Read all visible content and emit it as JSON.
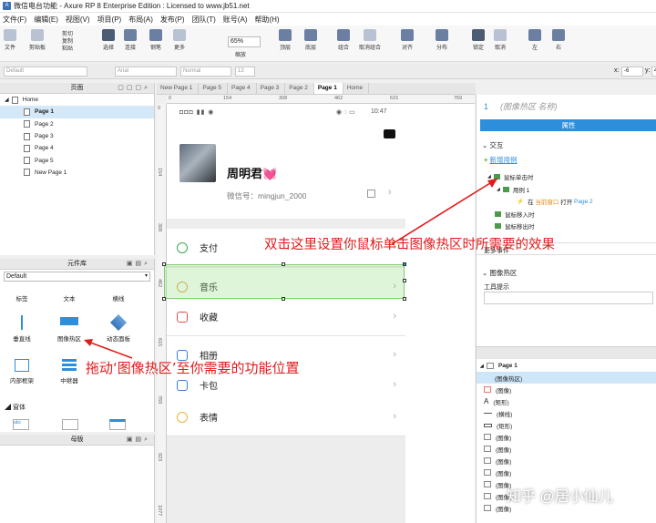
{
  "window": {
    "title": "微信电台功能 - Axure RP 8 Enterprise Edition : Licensed to www.jb51.net"
  },
  "menu": [
    "文件(F)",
    "编辑(E)",
    "视图(V)",
    "项目(P)",
    "布局(A)",
    "发布(P)",
    "团队(T)",
    "账号(A)",
    "帮助(H)"
  ],
  "toolbar": {
    "items": [
      "文件",
      "剪贴板",
      "选择",
      "连接",
      "钢笔",
      "更多",
      "缩放",
      "顶层",
      "底层",
      "组合",
      "取消组合",
      "对齐",
      "分布",
      "锁定",
      "取消",
      "左",
      "右"
    ],
    "small_items": [
      "剪切",
      "复制",
      "粘贴"
    ],
    "zoom_value": "65%"
  },
  "formatbar": {
    "style": "Default",
    "font": "Arial",
    "weight": "Normal",
    "size": "13",
    "x_label": "x:",
    "x_value": "-6",
    "y_label": "y:",
    "y_value": "4"
  },
  "pages_panel": {
    "title": "页面",
    "root": "Home",
    "pages": [
      "Page 1",
      "Page 2",
      "Page 3",
      "Page 4",
      "Page 5",
      "New Page 1"
    ]
  },
  "library_panel": {
    "title": "元件库",
    "selected_library": "Default",
    "items": [
      "标签",
      "文本",
      "横线",
      "垂直线",
      "图像热区",
      "动态面板",
      "内部框架",
      "中继器"
    ],
    "section": "窗体"
  },
  "masters_panel": {
    "title": "母版"
  },
  "tabs": [
    "New Page 1",
    "Page 5",
    "Page 4",
    "Page 3",
    "Page 2",
    "Page 1",
    "Home"
  ],
  "rulers": {
    "h": [
      "0",
      "154",
      "308",
      "462",
      "615",
      "769"
    ],
    "v": [
      "0",
      "154",
      "308",
      "462",
      "615",
      "769",
      "923",
      "1077"
    ]
  },
  "phone": {
    "status_time": "10:47",
    "status_left": "◘◘◘ ▮▮ ◉",
    "user_name": "周明君💓",
    "wechat_id": "微信号：mingjun_2000",
    "menu": [
      "支付",
      "音乐",
      "收藏",
      "相册",
      "卡包",
      "表情"
    ]
  },
  "inspector": {
    "page_number": "1",
    "widget_name_placeholder": "(图像热区 名称)",
    "tab": "属性",
    "section_interaction": "交互",
    "new_case": "新增用例",
    "events": [
      "鼠标单击时",
      "鼠标移入时",
      "鼠标移出时"
    ],
    "case_name": "用例 1",
    "action": "在 当前窗口 打开 Page 2",
    "action_prefix": "在",
    "action_mid": "当前窗口",
    "action_open": "打开",
    "action_target": "Page 2",
    "more_events": "更多事件",
    "section_hotspot": "图像热区",
    "tooltip_label": "工具提示"
  },
  "outline": {
    "page": "Page 1",
    "items": [
      "(图像热区)",
      "(图像)",
      "(矩形)",
      "(横线)",
      "(矩形)",
      "(图像)",
      "(图像)",
      "(图像)",
      "(图像)",
      "(图像)",
      "(图像)",
      "(图像)"
    ]
  },
  "annotations": {
    "double_click": "双击这里设置你鼠标单击图像热区时所需要的效果",
    "drag": "拖动‘图像热区’至你需要的功能位置"
  },
  "watermark": "知乎 @居小仙儿",
  "colors": {
    "annotation": "#e21b1b",
    "selection": "#d5e8f7",
    "hotspot": "#7fcf6f",
    "accent": "#2d8fdc"
  }
}
